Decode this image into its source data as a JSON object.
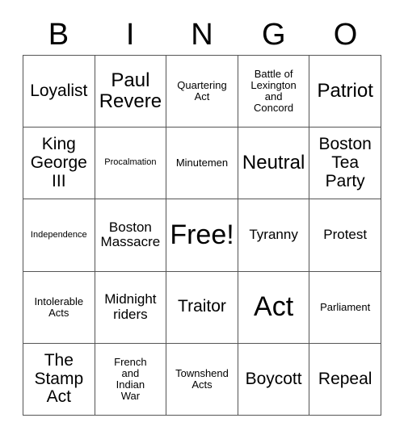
{
  "card": {
    "header": {
      "letters": [
        "B",
        "I",
        "N",
        "G",
        "O"
      ]
    },
    "grid": {
      "columns": 5,
      "rows": 5,
      "border_color": "#555555",
      "background_color": "#ffffff",
      "text_color": "#000000",
      "cells": [
        {
          "text": "Loyalist",
          "size": "l"
        },
        {
          "text": "Paul\nRevere",
          "size": "xl"
        },
        {
          "text": "Quartering\nAct",
          "size": "s"
        },
        {
          "text": "Battle of\nLexington\nand\nConcord",
          "size": "s"
        },
        {
          "text": "Patriot",
          "size": "xl"
        },
        {
          "text": "King\nGeorge\nIII",
          "size": "l"
        },
        {
          "text": "Procalmation",
          "size": "xs"
        },
        {
          "text": "Minutemen",
          "size": "s"
        },
        {
          "text": "Neutral",
          "size": "xl"
        },
        {
          "text": "Boston\nTea\nParty",
          "size": "l"
        },
        {
          "text": "Independence",
          "size": "xs"
        },
        {
          "text": "Boston\nMassacre",
          "size": "m"
        },
        {
          "text": "Free!",
          "size": "xxl"
        },
        {
          "text": "Tyranny",
          "size": "m"
        },
        {
          "text": "Protest",
          "size": "m"
        },
        {
          "text": "Intolerable\nActs",
          "size": "s"
        },
        {
          "text": "Midnight\nriders",
          "size": "m"
        },
        {
          "text": "Traitor",
          "size": "l"
        },
        {
          "text": "Act",
          "size": "xxl"
        },
        {
          "text": "Parliament",
          "size": "s"
        },
        {
          "text": "The\nStamp\nAct",
          "size": "l"
        },
        {
          "text": "French\nand\nIndian\nWar",
          "size": "s"
        },
        {
          "text": "Townshend\nActs",
          "size": "s"
        },
        {
          "text": "Boycott",
          "size": "l"
        },
        {
          "text": "Repeal",
          "size": "l"
        }
      ]
    }
  }
}
